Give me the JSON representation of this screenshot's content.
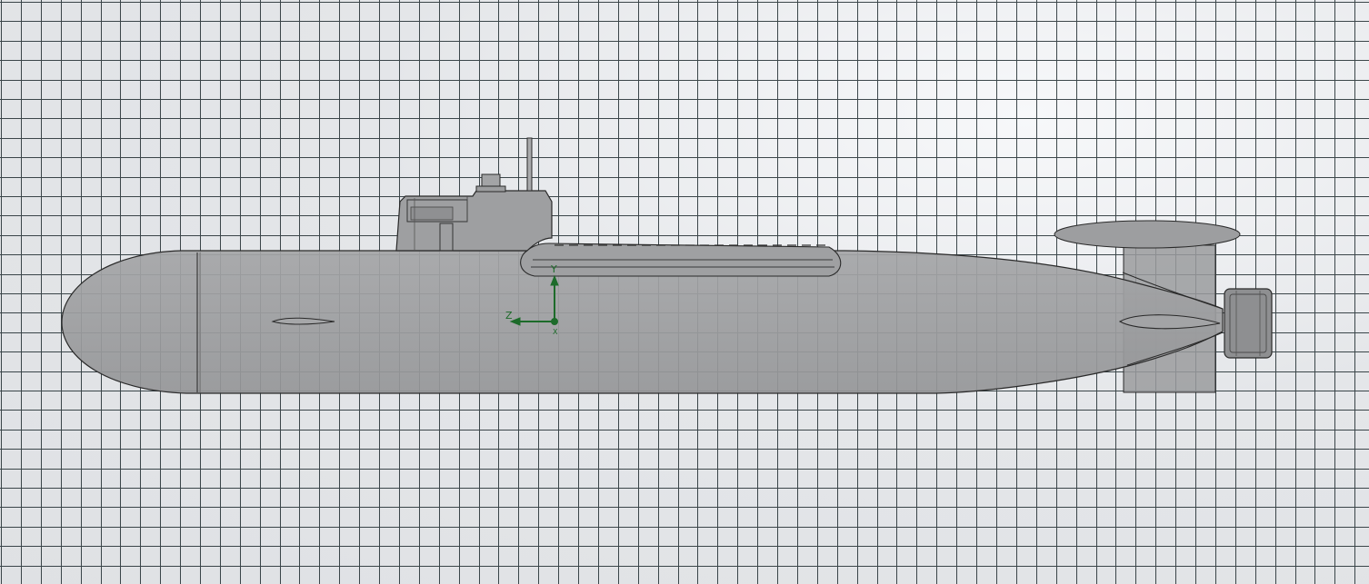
{
  "viewport": {
    "background_color": "#e4e6e9",
    "grid": {
      "line_color": "#1e2a2e"
    },
    "model": {
      "kind": "submarine-side-view",
      "hull_fill": "#9b9c9e",
      "edge_color": "#2a2a2a",
      "shadow_fill": "#8a8b8d"
    },
    "triad": {
      "color": "#1d6b2a",
      "axes": [
        "Y",
        "Z",
        "X"
      ]
    }
  }
}
